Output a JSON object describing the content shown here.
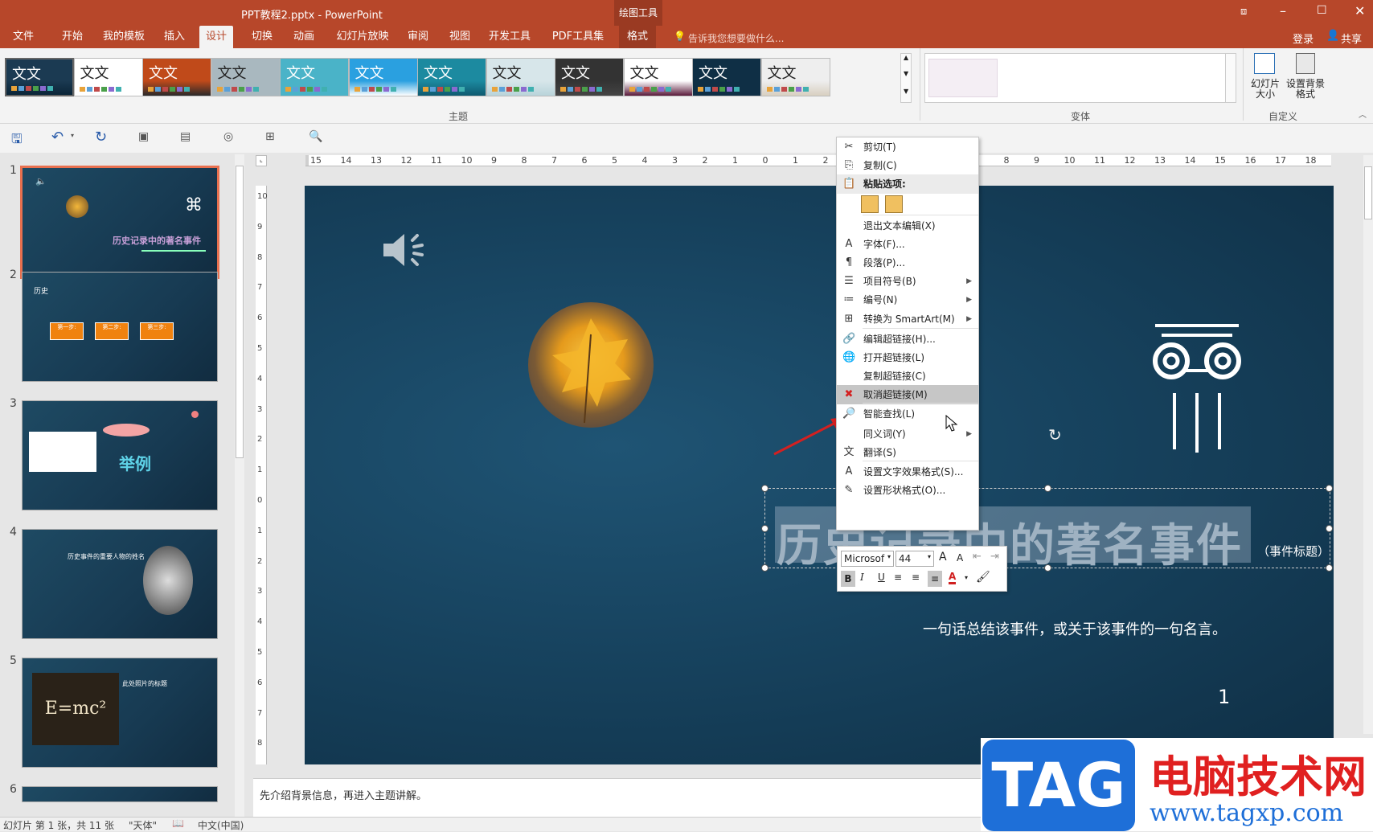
{
  "window": {
    "title": "PPT教程2.pptx - PowerPoint",
    "contextual_tab_group": "绘图工具"
  },
  "tabs": [
    {
      "label": "文件"
    },
    {
      "label": "开始"
    },
    {
      "label": "我的模板"
    },
    {
      "label": "插入"
    },
    {
      "label": "设计",
      "active": true
    },
    {
      "label": "切换"
    },
    {
      "label": "动画"
    },
    {
      "label": "幻灯片放映"
    },
    {
      "label": "审阅"
    },
    {
      "label": "视图"
    },
    {
      "label": "开发工具"
    },
    {
      "label": "PDF工具集"
    },
    {
      "label": "格式"
    }
  ],
  "tell_me": "告诉我您想要做什么...",
  "account": {
    "login": "登录",
    "share": "共享"
  },
  "ribbon": {
    "themes_group": "主题",
    "theme_sample": "文文",
    "variants_group": "变体",
    "customize_group": "自定义",
    "slide_size": "幻灯片大小",
    "background_format": "设置背景格式"
  },
  "ruler": {
    "horizontal": [
      "15",
      "14",
      "13",
      "12",
      "11",
      "10",
      "9",
      "8",
      "7",
      "6",
      "5",
      "4",
      "3",
      "2",
      "1",
      "0",
      "1",
      "2",
      "3",
      "4",
      "5",
      "6",
      "7",
      "8",
      "9",
      "10",
      "11",
      "12",
      "13",
      "14",
      "15",
      "16",
      "17",
      "18"
    ],
    "vertical": [
      "10",
      "9",
      "8",
      "7",
      "6",
      "5",
      "4",
      "3",
      "2",
      "1",
      "0",
      "1",
      "2",
      "3",
      "4",
      "5",
      "6",
      "7",
      "8"
    ]
  },
  "slides": [
    {
      "number": "1",
      "title": "历史记录中的著名事件",
      "selected": true
    },
    {
      "number": "2",
      "title": "历史",
      "steps": [
        "第一步:",
        "第二步:",
        "第三步:"
      ]
    },
    {
      "number": "3",
      "title": "举例"
    },
    {
      "number": "4",
      "title": "历史事件的重要人物的姓名"
    },
    {
      "number": "5",
      "title": "此处照片的标题",
      "formula": "E=mc²"
    },
    {
      "number": "6"
    }
  ],
  "slide_main": {
    "title": "历史记录中的著名事件",
    "title_suffix": "（事件标题）",
    "subtitle": "一句话总结该事件，或关于该事件的一句名言。",
    "page_number": "1"
  },
  "context_menu": [
    {
      "label": "剪切(T)",
      "icon": "scissors-icon"
    },
    {
      "label": "复制(C)",
      "icon": "copy-icon"
    },
    {
      "label": "粘贴选项:",
      "icon": "paste-icon",
      "header": true
    },
    {
      "label": "退出文本编辑(X)",
      "icon": ""
    },
    {
      "label": "字体(F)...",
      "icon": "font-icon"
    },
    {
      "label": "段落(P)...",
      "icon": "paragraph-icon"
    },
    {
      "label": "项目符号(B)",
      "icon": "bullets-icon",
      "submenu": true
    },
    {
      "label": "编号(N)",
      "icon": "numbering-icon",
      "submenu": true
    },
    {
      "label": "转换为 SmartArt(M)",
      "icon": "smartart-icon",
      "submenu": true
    },
    {
      "label": "编辑超链接(H)...",
      "icon": "edit-link-icon"
    },
    {
      "label": "打开超链接(L)",
      "icon": "open-link-icon"
    },
    {
      "label": "复制超链接(C)",
      "icon": ""
    },
    {
      "label": "取消超链接(M)",
      "icon": "remove-link-icon",
      "highlighted": true
    },
    {
      "label": "智能查找(L)",
      "icon": "smart-lookup-icon"
    },
    {
      "label": "同义词(Y)",
      "icon": "",
      "submenu": true
    },
    {
      "label": "翻译(S)",
      "icon": "translate-icon"
    },
    {
      "label": "设置文字效果格式(S)...",
      "icon": "text-effect-icon"
    },
    {
      "label": "设置形状格式(O)...",
      "icon": "shape-format-icon"
    }
  ],
  "mini_toolbar": {
    "font": "Microsof",
    "size": "44"
  },
  "notes": "先介绍背景信息，再进入主题讲解。",
  "status": {
    "slide": "幻灯片 第 1 张，共 11 张",
    "theme": "\"天体\"",
    "language": "中文(中国)"
  },
  "watermark": {
    "tag": "TAG",
    "title": "电脑技术网",
    "url": "www.tagxp.com"
  },
  "colors": {
    "accent": "#b7472a",
    "slide_bg": "#17435f",
    "highlight": "#c6c6c6"
  }
}
